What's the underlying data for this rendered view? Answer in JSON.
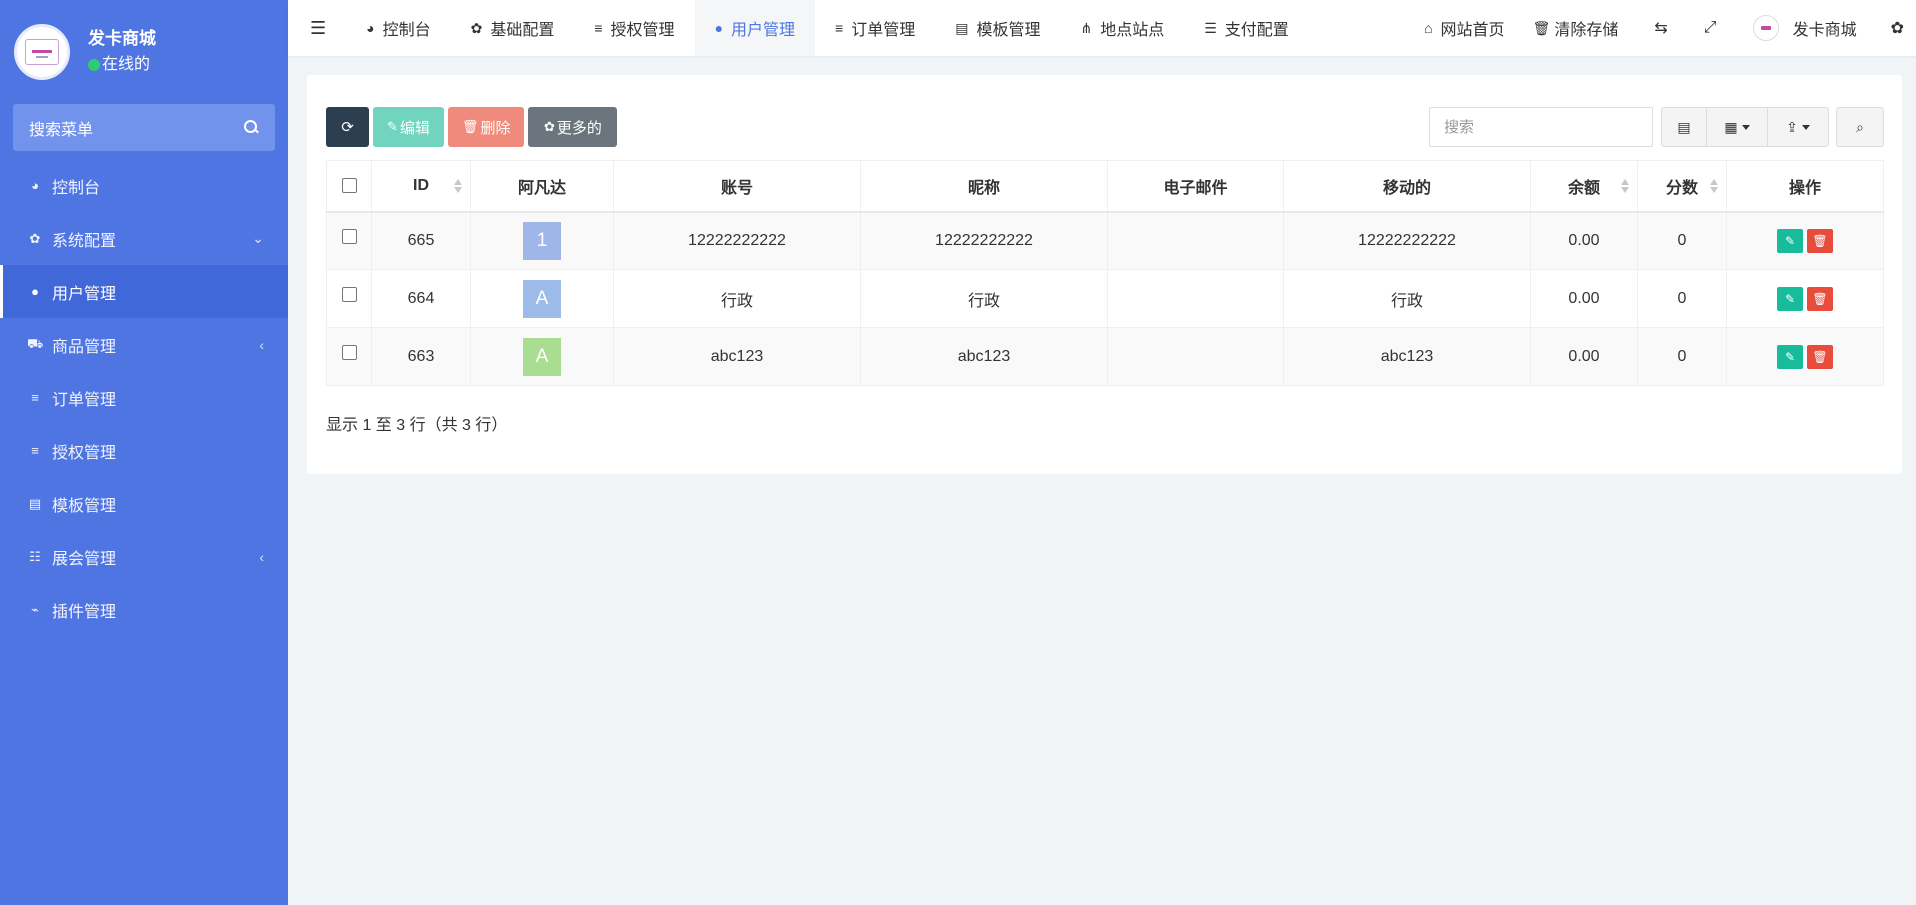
{
  "brand": {
    "name": "发卡商城",
    "status": "在线的"
  },
  "sidebar": {
    "search_placeholder": "搜索菜单",
    "items": [
      {
        "label": "控制台",
        "icon": "dashboard-icon",
        "glyph": "◕",
        "arrow": ""
      },
      {
        "label": "系统配置",
        "icon": "gear-icon",
        "glyph": "✿",
        "arrow": "⌄"
      },
      {
        "label": "用户管理",
        "icon": "user-icon",
        "glyph": "●",
        "arrow": "",
        "active": true
      },
      {
        "label": "商品管理",
        "icon": "cart-icon",
        "glyph": "⛟",
        "arrow": "‹"
      },
      {
        "label": "订单管理",
        "icon": "list-icon",
        "glyph": "≡",
        "arrow": ""
      },
      {
        "label": "授权管理",
        "icon": "list-icon",
        "glyph": "≡",
        "arrow": ""
      },
      {
        "label": "模板管理",
        "icon": "template-icon",
        "glyph": "▤",
        "arrow": ""
      },
      {
        "label": "展会管理",
        "icon": "sliders-icon",
        "glyph": "☷",
        "arrow": "‹"
      },
      {
        "label": "插件管理",
        "icon": "plug-icon",
        "glyph": "⌁",
        "arrow": ""
      }
    ]
  },
  "topnav": {
    "tabs": [
      {
        "label": "控制台",
        "icon": "dashboard-icon",
        "glyph": "◕"
      },
      {
        "label": "基础配置",
        "icon": "gear-icon",
        "glyph": "✿"
      },
      {
        "label": "授权管理",
        "icon": "list-icon",
        "glyph": "≡"
      },
      {
        "label": "用户管理",
        "icon": "user-icon",
        "glyph": "●",
        "active": true
      },
      {
        "label": "订单管理",
        "icon": "list-icon",
        "glyph": "≡"
      },
      {
        "label": "模板管理",
        "icon": "template-icon",
        "glyph": "▤"
      },
      {
        "label": "地点站点",
        "icon": "sitemap-icon",
        "glyph": "⋔"
      },
      {
        "label": "支付配置",
        "icon": "server-icon",
        "glyph": "☰"
      }
    ],
    "home": "网站首页",
    "clear_cache": "清除存储",
    "user_name": "发卡商城"
  },
  "toolbar": {
    "edit_label": "编辑",
    "delete_label": "删除",
    "more_label": "更多的",
    "search_placeholder": "搜索"
  },
  "table": {
    "columns": [
      "ID",
      "阿凡达",
      "账号",
      "昵称",
      "电子邮件",
      "移动的",
      "余额",
      "分数",
      "操作"
    ],
    "rows": [
      {
        "id": "665",
        "avatar": "1",
        "avatar_color": "#9fb6e8",
        "account": "12222222222",
        "nickname": "12222222222",
        "email": "",
        "mobile": "12222222222",
        "balance": "0.00",
        "score": "0"
      },
      {
        "id": "664",
        "avatar": "A",
        "avatar_color": "#9cbbe9",
        "account": "行政",
        "nickname": "行政",
        "email": "",
        "mobile": "行政",
        "balance": "0.00",
        "score": "0"
      },
      {
        "id": "663",
        "avatar": "A",
        "avatar_color": "#a8dd92",
        "account": "abc123",
        "nickname": "abc123",
        "email": "",
        "mobile": "abc123",
        "balance": "0.00",
        "score": "0"
      }
    ]
  },
  "pagination": {
    "info": "显示 1 至 3 行（共 3 行）"
  },
  "colors": {
    "sidebar": "#4f75e2",
    "accent": "#4f75e2",
    "edit": "#18bc9c",
    "delete": "#e74c3c"
  }
}
